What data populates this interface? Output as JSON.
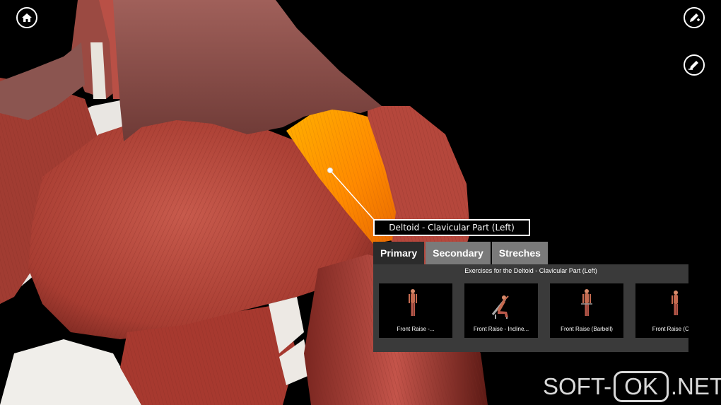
{
  "muscle_label": "Deltoid - Clavicular Part (Left)",
  "tabs": [
    {
      "label": "Primary",
      "active": true
    },
    {
      "label": "Secondary",
      "active": false
    },
    {
      "label": "Streches",
      "active": false
    }
  ],
  "panel_title": "Exercises for the Deltoid - Clavicular Part (Left)",
  "exercises": [
    {
      "label": "Front Raise -..."
    },
    {
      "label": "Front Raise - Incline..."
    },
    {
      "label": "Front Raise (Barbell)"
    },
    {
      "label": "Front Raise (Ca"
    }
  ],
  "watermark": {
    "left": "SOFT-",
    "boxed": "OK",
    "right": ".NET"
  },
  "icons": {
    "home": "home-icon",
    "draw": "pencil-add-icon",
    "erase": "pencil-remove-icon"
  }
}
